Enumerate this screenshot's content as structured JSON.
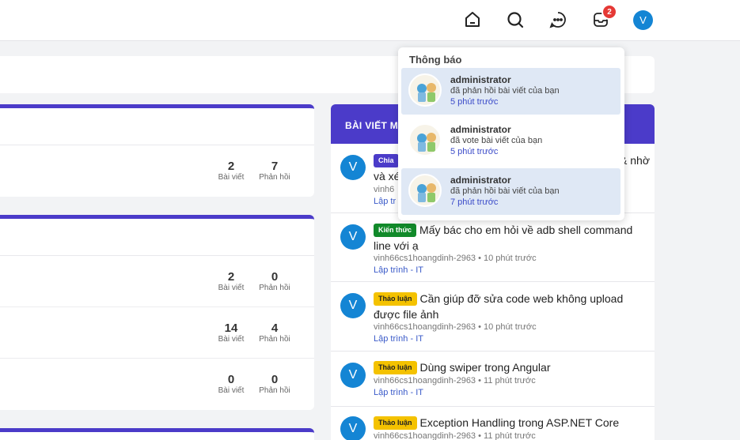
{
  "header": {
    "notification_count": "2",
    "user_initial": "V"
  },
  "left_cards": [
    {
      "rows": [
        {
          "posts": "2",
          "posts_label": "Bài viết",
          "replies": "7",
          "replies_label": "Phản hồi"
        }
      ]
    },
    {
      "rows": [
        {
          "posts": "2",
          "posts_label": "Bài viết",
          "replies": "0",
          "replies_label": "Phản hồi"
        },
        {
          "posts": "14",
          "posts_label": "Bài viết",
          "replies": "4",
          "replies_label": "Phản hồi"
        },
        {
          "posts": "0",
          "posts_label": "Bài viết",
          "replies": "0",
          "replies_label": "Phản hồi"
        }
      ]
    }
  ],
  "latest": {
    "heading": "BÀI VIẾT M",
    "posts": [
      {
        "avatar": "V",
        "tag": "Chia",
        "title": "& nhờ",
        "title2": "và xé",
        "meta": "vinh6",
        "category": "Lập tr"
      },
      {
        "avatar": "V",
        "tag": "Kiến thức",
        "title": "Mấy bác cho em hỏi về adb shell command line với ạ",
        "meta": "vinh66cs1hoangdinh-2963 • 10 phút trước",
        "category": "Lập trình - IT"
      },
      {
        "avatar": "V",
        "tag": "Thảo luận",
        "title": "Cần giúp đỡ sửa code web không upload được file ảnh",
        "meta": "vinh66cs1hoangdinh-2963 • 10 phút trước",
        "category": "Lập trình - IT"
      },
      {
        "avatar": "V",
        "tag": "Thảo luận",
        "title": "Dùng swiper trong Angular",
        "meta": "vinh66cs1hoangdinh-2963 • 11 phút trước",
        "category": "Lập trình - IT"
      },
      {
        "avatar": "V",
        "tag": "Thảo luận",
        "title": "Exception Handling trong ASP.NET Core",
        "meta": "vinh66cs1hoangdinh-2963 • 11 phút trước",
        "category": ""
      }
    ]
  },
  "notifications": {
    "title": "Thông báo",
    "items": [
      {
        "name": "administrator",
        "message": "đã phản hồi bài viết của bạn",
        "time": "5 phút trước",
        "unread": true
      },
      {
        "name": "administrator",
        "message": "đã vote bài viết của bạn",
        "time": "5 phút trước",
        "unread": false
      },
      {
        "name": "administrator",
        "message": "đã phản hồi bài viết của bạn",
        "time": "7 phút trước",
        "unread": true
      }
    ]
  },
  "colors": {
    "accent": "#4b3bc9",
    "avatar": "#1485d4",
    "badge": "#e53935",
    "tag_green": "#118a2a",
    "tag_yellow": "#f4c200"
  },
  "icons": [
    "home-icon",
    "search-icon",
    "chat-icon",
    "notification-icon"
  ]
}
